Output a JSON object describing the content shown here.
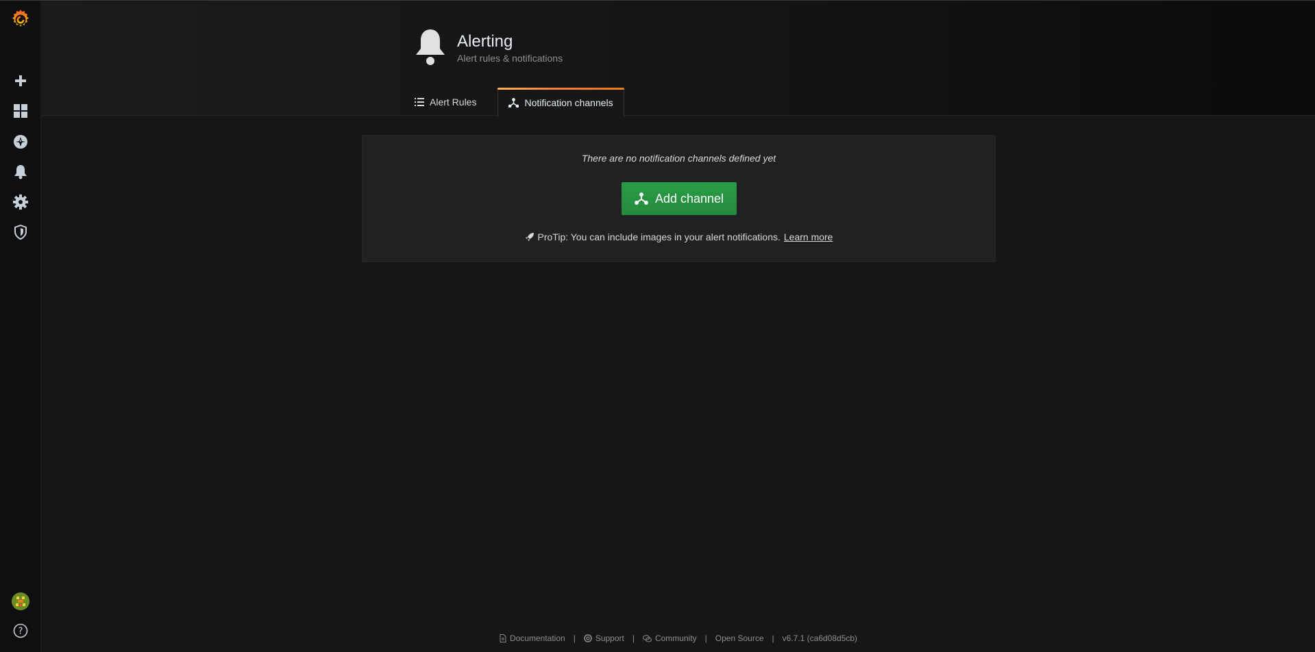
{
  "app": {
    "logo": "grafana-logo-icon",
    "brand_colors": {
      "orange": "#f46800",
      "yellow": "#fbca0a"
    }
  },
  "sidebar": {
    "items": [
      {
        "name": "create",
        "icon": "plus-icon"
      },
      {
        "name": "dashboards",
        "icon": "dashboards-grid-icon"
      },
      {
        "name": "explore",
        "icon": "compass-icon"
      },
      {
        "name": "alerting",
        "icon": "bell-icon"
      },
      {
        "name": "configuration",
        "icon": "gear-icon"
      },
      {
        "name": "server-admin",
        "icon": "shield-icon"
      }
    ],
    "bottom": [
      {
        "name": "profile",
        "icon": "avatar-icon"
      },
      {
        "name": "help",
        "icon": "question-circle-icon"
      }
    ]
  },
  "header": {
    "title": "Alerting",
    "subtitle": "Alert rules & notifications",
    "icon": "bell-icon"
  },
  "tabs": [
    {
      "label": "Alert Rules",
      "icon": "list-icon",
      "active": false
    },
    {
      "label": "Notification channels",
      "icon": "channels-icon",
      "active": true
    }
  ],
  "cta": {
    "title": "There are no notification channels defined yet",
    "button_label": "Add channel",
    "button_icon": "channels-icon",
    "protip": "ProTip: You can include images in your alert notifications.",
    "protip_icon": "rocket-icon",
    "learn_more": "Learn more",
    "button_color": "#299c46"
  },
  "footer": {
    "documentation": "Documentation",
    "support": "Support",
    "community": "Community",
    "open_source": "Open Source",
    "version": "v6.7.1 (ca6d08d5cb)",
    "separator": "|"
  }
}
